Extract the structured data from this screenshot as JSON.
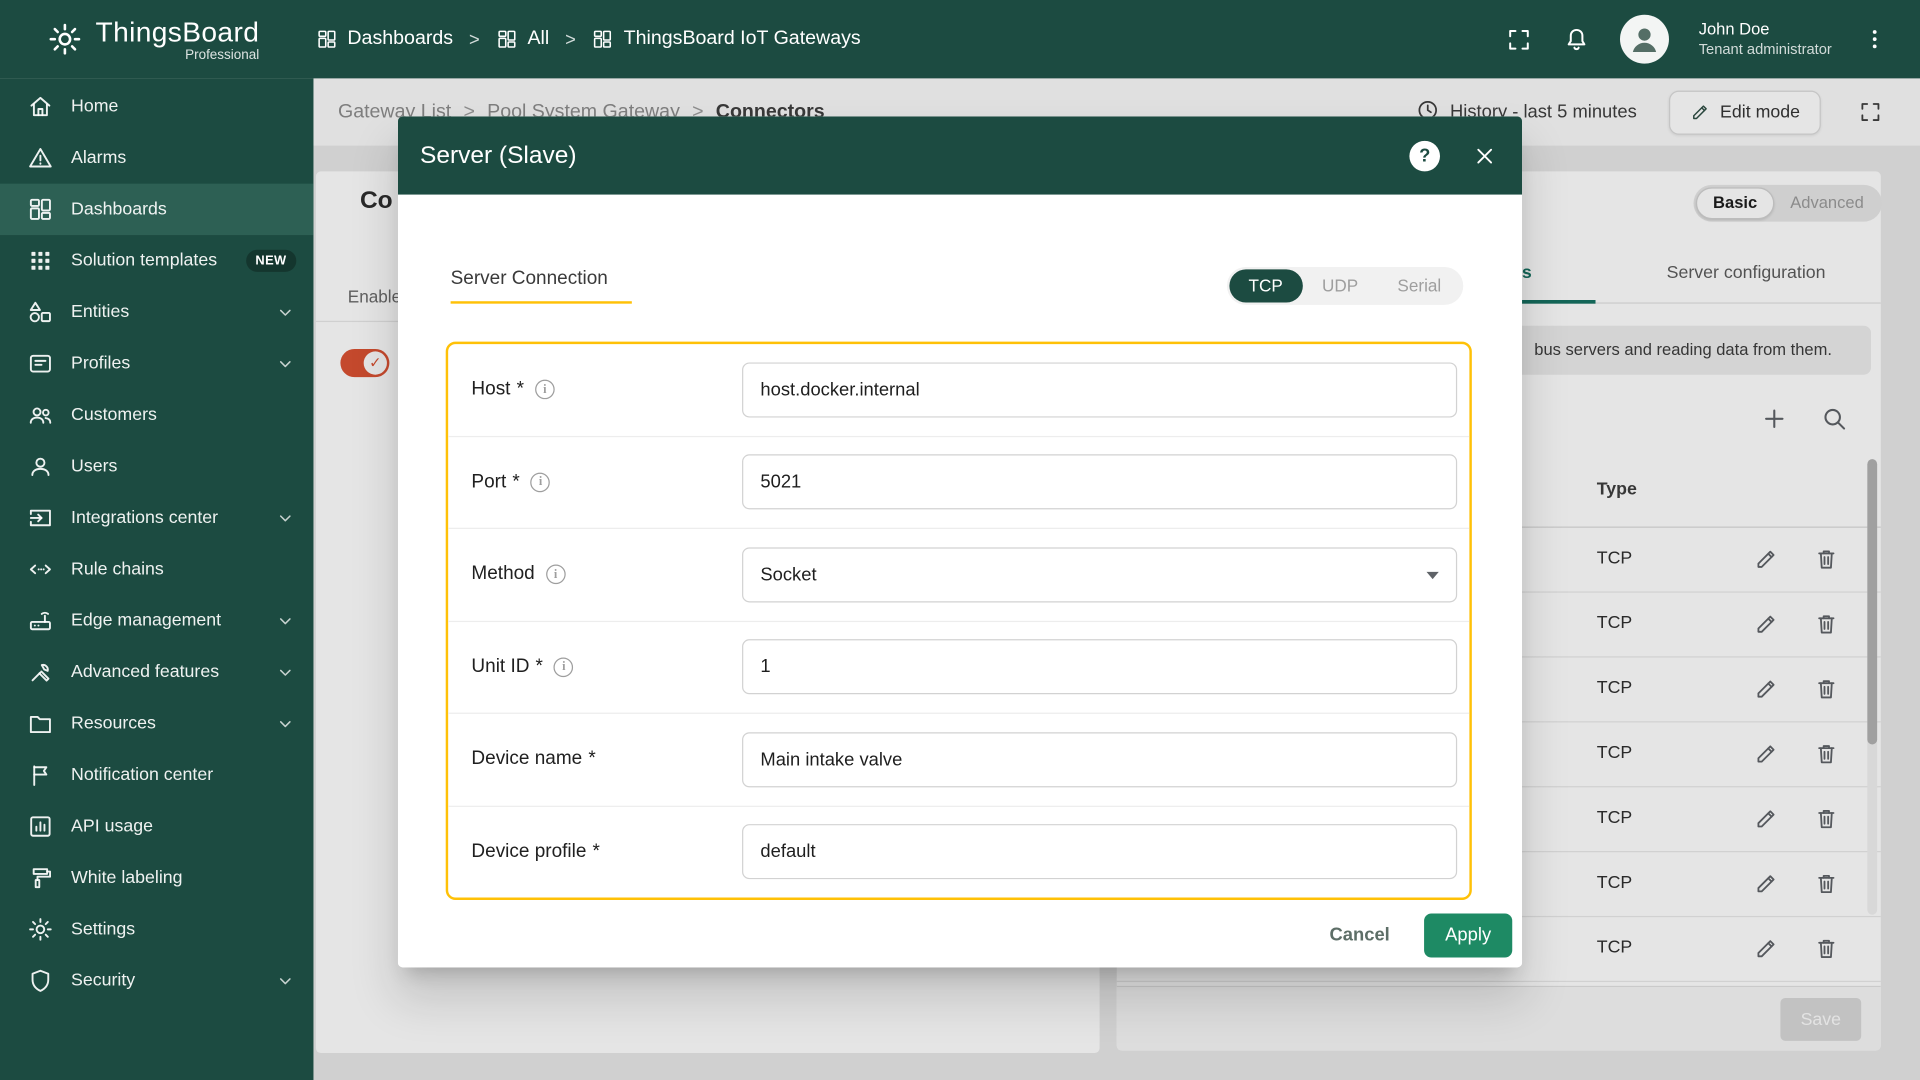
{
  "app": {
    "brand": "ThingsBoard",
    "brand_sub": "Professional",
    "user_name": "John Doe",
    "user_role": "Tenant administrator"
  },
  "topbar": {
    "separator": ">",
    "breadcrumbs": [
      {
        "label": "Dashboards",
        "icon": "dashboards"
      },
      {
        "label": "All",
        "icon": "dashboards"
      },
      {
        "label": "ThingsBoard IoT Gateways",
        "icon": "dashboards"
      }
    ]
  },
  "sidebar": {
    "items": [
      {
        "label": "Home",
        "icon": "home"
      },
      {
        "label": "Alarms",
        "icon": "alarm"
      },
      {
        "label": "Dashboards",
        "icon": "dashboards",
        "active": true
      },
      {
        "label": "Solution templates",
        "icon": "apps",
        "badge": "NEW"
      },
      {
        "label": "Entities",
        "icon": "category",
        "expandable": true
      },
      {
        "label": "Profiles",
        "icon": "badge",
        "expandable": true
      },
      {
        "label": "Customers",
        "icon": "group"
      },
      {
        "label": "Users",
        "icon": "person"
      },
      {
        "label": "Integrations center",
        "icon": "input",
        "expandable": true
      },
      {
        "label": "Rule chains",
        "icon": "code"
      },
      {
        "label": "Edge management",
        "icon": "router",
        "expandable": true
      },
      {
        "label": "Advanced features",
        "icon": "tools",
        "expandable": true
      },
      {
        "label": "Resources",
        "icon": "folder",
        "expandable": true
      },
      {
        "label": "Notification center",
        "icon": "flag"
      },
      {
        "label": "API usage",
        "icon": "chart-box"
      },
      {
        "label": "White labeling",
        "icon": "paint"
      },
      {
        "label": "Settings",
        "icon": "gear"
      },
      {
        "label": "Security",
        "icon": "shield",
        "expandable": true
      }
    ]
  },
  "toolbar": {
    "separator": ">",
    "breadcrumbs": [
      "Gateway List",
      "Pool System Gateway",
      "Connectors"
    ],
    "history_label": "History - last 5 minutes",
    "edit_mode_label": "Edit mode"
  },
  "content": {
    "left_panel": {
      "title_fragment": "Co",
      "enabled_header_fragment": "Enable",
      "row_toggle_checked": true
    },
    "right_panel": {
      "view_toggle": {
        "options": [
          "Basic",
          "Advanced"
        ],
        "selected": "Basic"
      },
      "tabs": {
        "active_fragment": "ns",
        "second": "Server configuration"
      },
      "hint_fragment": "bus servers and reading data from them.",
      "table": {
        "type_header": "Type",
        "rows": [
          "TCP",
          "TCP",
          "TCP",
          "TCP",
          "TCP",
          "TCP",
          "TCP"
        ]
      },
      "save_label": "Save"
    }
  },
  "modal": {
    "title": "Server (Slave)",
    "section_title": "Server Connection",
    "protocols": {
      "options": [
        "TCP",
        "UDP",
        "Serial"
      ],
      "selected": "TCP"
    },
    "fields": [
      {
        "label": "Host",
        "required": true,
        "info": true,
        "control": "input",
        "value": "host.docker.internal"
      },
      {
        "label": "Port",
        "required": true,
        "info": true,
        "control": "input",
        "value": "5021"
      },
      {
        "label": "Method",
        "required": false,
        "info": true,
        "control": "select",
        "value": "Socket"
      },
      {
        "label": "Unit ID",
        "required": true,
        "info": true,
        "control": "input",
        "value": "1"
      },
      {
        "label": "Device name",
        "required": true,
        "info": false,
        "control": "input",
        "value": "Main intake valve"
      },
      {
        "label": "Device profile",
        "required": true,
        "info": false,
        "control": "input",
        "value": "default"
      }
    ],
    "cancel_label": "Cancel",
    "apply_label": "Apply"
  },
  "colors": {
    "primary_dark": "#1c4b41",
    "accent_yellow": "#ffc107",
    "apply_green": "#1e8a64",
    "active_tab_teal": "#177262",
    "toggle_orange": "#db5233"
  }
}
